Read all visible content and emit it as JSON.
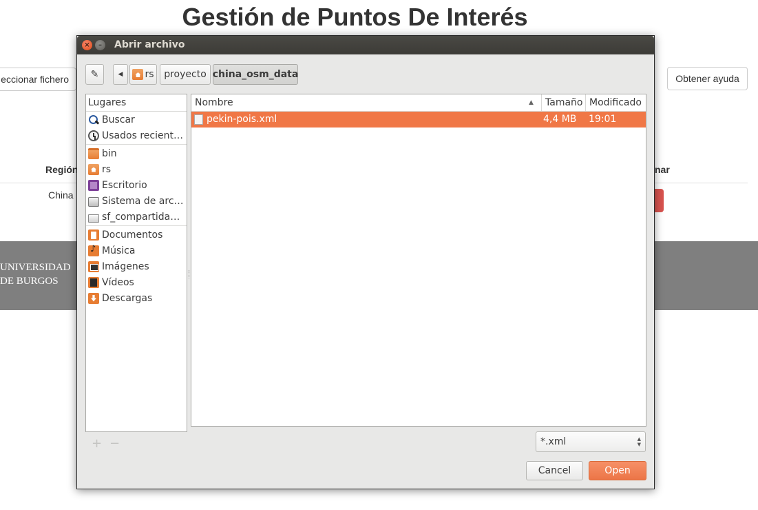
{
  "page": {
    "title": "Gestión de Puntos De Interés",
    "select_file_button": "eccionar fichero",
    "help_button": "Obtener ayuda",
    "table": {
      "header_region": "Región",
      "header_right": "nar",
      "rows": [
        {
          "region": "China"
        }
      ]
    },
    "footer": {
      "logo_line1": "UNIVERSIDAD",
      "logo_line2": "DE BURGOS"
    }
  },
  "dialog": {
    "title": "Abrir archivo",
    "path": [
      {
        "label": "rs",
        "icon": "home-folder-icon"
      },
      {
        "label": "proyecto"
      },
      {
        "label": "china_osm_data",
        "active": true
      }
    ],
    "places_header": "Lugares",
    "places": [
      {
        "label": "Buscar",
        "icon": "search-icon"
      },
      {
        "label": "Usados recient…",
        "icon": "recent-icon"
      },
      {
        "label": "bin",
        "icon": "folder-icon"
      },
      {
        "label": "rs",
        "icon": "home-folder-icon"
      },
      {
        "label": "Escritorio",
        "icon": "desktop-icon"
      },
      {
        "label": "Sistema de arc…",
        "icon": "drive-icon"
      },
      {
        "label": "sf_compartida…",
        "icon": "share-drive-icon"
      },
      {
        "label": "Documentos",
        "icon": "documents-folder-icon"
      },
      {
        "label": "Música",
        "icon": "music-folder-icon"
      },
      {
        "label": "Imágenes",
        "icon": "pictures-folder-icon"
      },
      {
        "label": "Vídeos",
        "icon": "videos-folder-icon"
      },
      {
        "label": "Descargas",
        "icon": "downloads-folder-icon"
      }
    ],
    "columns": {
      "name": "Nombre",
      "size": "Tamaño",
      "modified": "Modificado"
    },
    "files": [
      {
        "name": "pekin-pois.xml",
        "size": "4,4 MB",
        "modified": "19:01",
        "selected": true
      }
    ],
    "add_place": "+",
    "remove_place": "−",
    "filter": "*.xml",
    "cancel_button": "Cancel",
    "open_button": "Open",
    "colors": {
      "selection": "#f07746",
      "titlebar": "#3c3b37",
      "open_button": "#ec7547"
    }
  }
}
